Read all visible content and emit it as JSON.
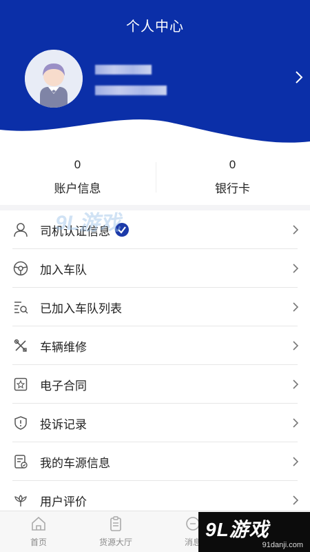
{
  "header": {
    "title": "个人中心",
    "background": "#0b2fa8"
  },
  "profile": {
    "avatar_icon": "user-avatar-icon",
    "arrow_icon": "chevron-right-icon"
  },
  "stats": [
    {
      "value": "0",
      "label": "账户信息"
    },
    {
      "value": "0",
      "label": "银行卡"
    }
  ],
  "menu": {
    "items": [
      {
        "label": "司机认证信息",
        "icon": "user-outline-icon",
        "verified": true
      },
      {
        "label": "加入车队",
        "icon": "steering-wheel-icon"
      },
      {
        "label": "已加入车队列表",
        "icon": "list-search-icon"
      },
      {
        "label": "车辆维修",
        "icon": "tools-icon"
      },
      {
        "label": "电子合同",
        "icon": "contract-icon"
      },
      {
        "label": "投诉记录",
        "icon": "shield-alert-icon"
      },
      {
        "label": "我的车源信息",
        "icon": "document-check-icon"
      },
      {
        "label": "用户评价",
        "icon": "flower-icon"
      }
    ]
  },
  "tabbar": {
    "tabs": [
      {
        "label": "首页",
        "icon": "home-icon"
      },
      {
        "label": "货源大厅",
        "icon": "clipboard-icon"
      },
      {
        "label": "消息",
        "icon": "message-icon"
      }
    ]
  },
  "watermark": {
    "logo_text": "9L游戏",
    "site": "91danji.com",
    "faint_text": "9L游戏"
  },
  "colors": {
    "brand_blue": "#0b2fa8",
    "verified_badge": "#1c3aa9",
    "tab_inactive": "#8a8a8a"
  }
}
